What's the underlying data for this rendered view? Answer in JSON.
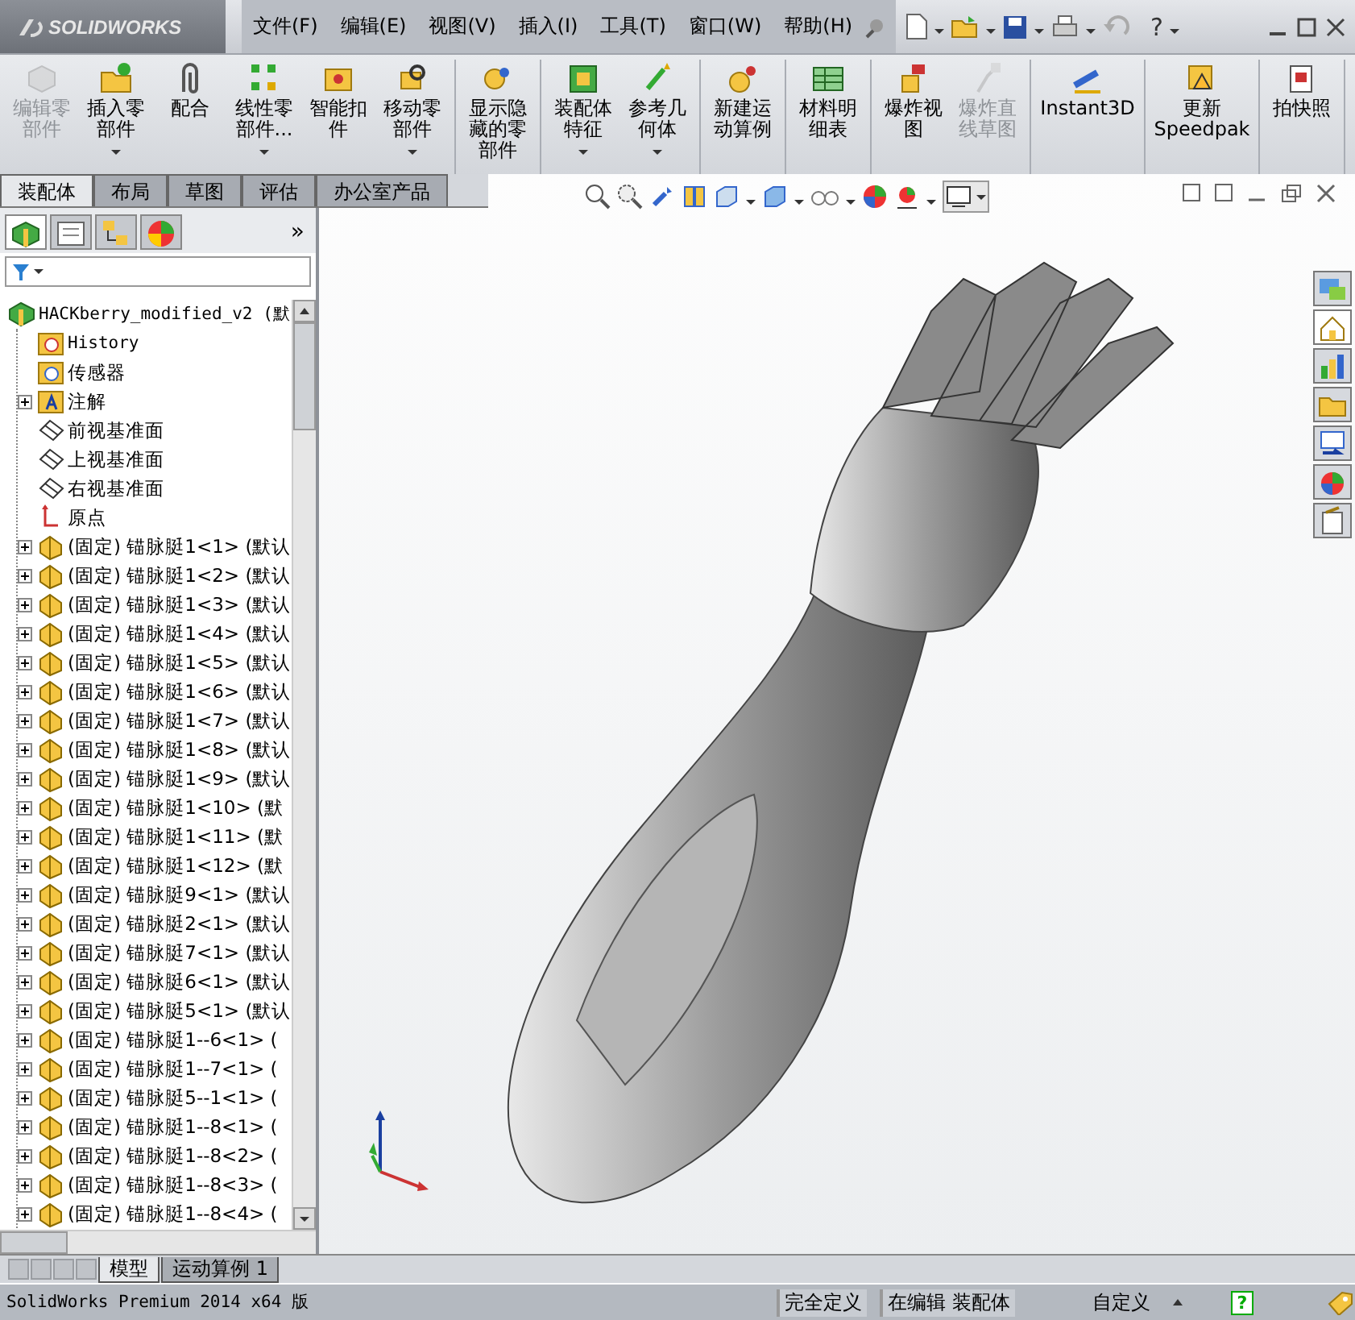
{
  "window": {
    "logo": "SOLIDWORKS",
    "menu": [
      "文件(F)",
      "编辑(E)",
      "视图(V)",
      "插入(I)",
      "工具(T)",
      "窗口(W)",
      "帮助(H)"
    ],
    "help_glyph": "?"
  },
  "ribbon_groups": [
    [
      {
        "label": "编辑零部件",
        "disabled": true,
        "menu": false
      },
      {
        "label": "插入零部件",
        "disabled": false,
        "menu": true
      },
      {
        "label": "配合",
        "disabled": false,
        "menu": false
      },
      {
        "label": "线性零部件...",
        "disabled": false,
        "menu": true
      },
      {
        "label": "智能扣件",
        "disabled": false,
        "menu": false
      },
      {
        "label": "移动零部件",
        "disabled": false,
        "menu": true
      }
    ],
    [
      {
        "label": "显示隐藏的零部件",
        "disabled": false,
        "menu": false
      }
    ],
    [
      {
        "label": "装配体特征",
        "disabled": false,
        "menu": true
      },
      {
        "label": "参考几何体",
        "disabled": false,
        "menu": true
      }
    ],
    [
      {
        "label": "新建运动算例",
        "disabled": false,
        "menu": false
      }
    ],
    [
      {
        "label": "材料明细表",
        "disabled": false,
        "menu": false
      }
    ],
    [
      {
        "label": "爆炸视图",
        "disabled": false,
        "menu": false
      },
      {
        "label": "爆炸直线草图",
        "disabled": true,
        "menu": false
      }
    ],
    [
      {
        "label": "Instant3D",
        "disabled": false,
        "menu": false
      }
    ],
    [
      {
        "label": "更新 Speedpak",
        "disabled": false,
        "menu": false
      }
    ],
    [
      {
        "label": "拍快照",
        "disabled": false,
        "menu": false
      }
    ]
  ],
  "command_tabs": [
    {
      "label": "装配体",
      "selected": true
    },
    {
      "label": "布局",
      "selected": false
    },
    {
      "label": "草图",
      "selected": false
    },
    {
      "label": "评估",
      "selected": false
    },
    {
      "label": "办公室产品",
      "selected": false
    }
  ],
  "panel_tabs": [
    {
      "selected": true
    },
    {
      "selected": false
    },
    {
      "selected": false
    },
    {
      "selected": false
    }
  ],
  "task_pane_tabs": [
    {
      "selected": false
    },
    {
      "selected": true
    },
    {
      "selected": false
    },
    {
      "selected": false
    },
    {
      "selected": false
    },
    {
      "selected": false
    },
    {
      "selected": false
    }
  ],
  "panel_more": "»",
  "tree": {
    "label": "HACKberry_modified_v2 (默",
    "kind": "assembly",
    "expandable": false,
    "children": [
      {
        "label": "History",
        "kind": "history",
        "expandable": false
      },
      {
        "label": "传感器",
        "kind": "sensor",
        "expandable": false
      },
      {
        "label": "注解",
        "kind": "annotation",
        "expandable": true
      },
      {
        "label": "前视基准面",
        "kind": "plane",
        "expandable": false
      },
      {
        "label": "上视基准面",
        "kind": "plane",
        "expandable": false
      },
      {
        "label": "右视基准面",
        "kind": "plane",
        "expandable": false
      },
      {
        "label": "原点",
        "kind": "origin",
        "expandable": false
      },
      {
        "label": "(固定) 锚脉脡1<1> (默认",
        "kind": "part",
        "expandable": true
      },
      {
        "label": "(固定) 锚脉脡1<2> (默认",
        "kind": "part",
        "expandable": true
      },
      {
        "label": "(固定) 锚脉脡1<3> (默认",
        "kind": "part",
        "expandable": true
      },
      {
        "label": "(固定) 锚脉脡1<4> (默认",
        "kind": "part",
        "expandable": true
      },
      {
        "label": "(固定) 锚脉脡1<5> (默认",
        "kind": "part",
        "expandable": true
      },
      {
        "label": "(固定) 锚脉脡1<6> (默认",
        "kind": "part",
        "expandable": true
      },
      {
        "label": "(固定) 锚脉脡1<7> (默认",
        "kind": "part",
        "expandable": true
      },
      {
        "label": "(固定) 锚脉脡1<8> (默认",
        "kind": "part",
        "expandable": true
      },
      {
        "label": "(固定) 锚脉脡1<9> (默认",
        "kind": "part",
        "expandable": true
      },
      {
        "label": "(固定) 锚脉脡1<10> (默",
        "kind": "part",
        "expandable": true
      },
      {
        "label": "(固定) 锚脉脡1<11> (默",
        "kind": "part",
        "expandable": true
      },
      {
        "label": "(固定) 锚脉脡1<12> (默",
        "kind": "part",
        "expandable": true
      },
      {
        "label": "(固定) 锚脉脡9<1> (默认",
        "kind": "part",
        "expandable": true
      },
      {
        "label": "(固定) 锚脉脡2<1> (默认",
        "kind": "part",
        "expandable": true
      },
      {
        "label": "(固定) 锚脉脡7<1> (默认",
        "kind": "part",
        "expandable": true
      },
      {
        "label": "(固定) 锚脉脡6<1> (默认",
        "kind": "part",
        "expandable": true
      },
      {
        "label": "(固定) 锚脉脡5<1> (默认",
        "kind": "part",
        "expandable": true
      },
      {
        "label": "(固定) 锚脉脡1--6<1> (",
        "kind": "part",
        "expandable": true
      },
      {
        "label": "(固定) 锚脉脡1--7<1> (",
        "kind": "part",
        "expandable": true
      },
      {
        "label": "(固定) 锚脉脡5--1<1> (",
        "kind": "part",
        "expandable": true
      },
      {
        "label": "(固定) 锚脉脡1--8<1> (",
        "kind": "part",
        "expandable": true
      },
      {
        "label": "(固定) 锚脉脡1--8<2> (",
        "kind": "part",
        "expandable": true
      },
      {
        "label": "(固定) 锚脉脡1--8<3> (",
        "kind": "part",
        "expandable": true
      },
      {
        "label": "(固定) 锚脉脡1--8<4> (",
        "kind": "part",
        "expandable": true
      }
    ]
  },
  "bottom_tabs": [
    {
      "label": "模型",
      "selected": true
    },
    {
      "label": "运动算例 1",
      "selected": false
    }
  ],
  "status_bar": {
    "product": "SolidWorks Premium 2014 x64 版",
    "definition": "完全定义",
    "editing": "在编辑 装配体",
    "units": "自定义",
    "help_glyph": "?"
  }
}
